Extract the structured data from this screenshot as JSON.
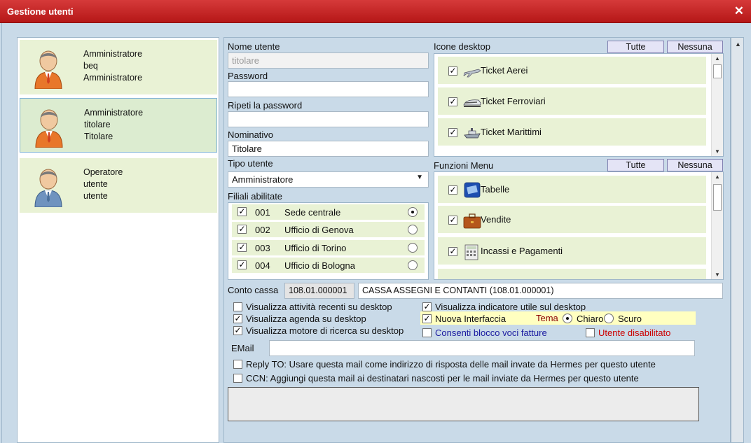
{
  "window": {
    "title": "Gestione utenti",
    "close_icon": "close-icon"
  },
  "users": [
    {
      "line1": "Amministratore",
      "line2": "beq",
      "line3": "Amministratore",
      "avatar_color": "#e8772a"
    },
    {
      "line1": "Amministratore",
      "line2": "titolare",
      "line3": "Titolare",
      "avatar_color": "#e8772a",
      "selected": true
    },
    {
      "line1": "Operatore",
      "line2": "utente",
      "line3": "utente",
      "avatar_color": "#6f93bf"
    }
  ],
  "form": {
    "nome_utente_label": "Nome utente",
    "nome_utente_placeholder": "titolare",
    "password_label": "Password",
    "password_value": "",
    "ripeti_label": "Ripeti la password",
    "ripeti_value": "",
    "nominativo_label": "Nominativo",
    "nominativo_value": "Titolare",
    "tipo_label": "Tipo utente",
    "tipo_value": "Amministratore",
    "filiali_label": "Filiali abilitate",
    "filiali": [
      {
        "code": "001",
        "name": "Sede centrale",
        "checked": true,
        "default": true
      },
      {
        "code": "002",
        "name": "Ufficio di Genova",
        "checked": true,
        "default": false
      },
      {
        "code": "003",
        "name": "Ufficio di Torino",
        "checked": true,
        "default": false
      },
      {
        "code": "004",
        "name": "Ufficio di Bologna",
        "checked": true,
        "default": false
      }
    ],
    "conto_cassa_label": "Conto cassa",
    "conto_cassa_code": "108.01.000001",
    "conto_cassa_desc": "CASSA ASSEGNI E CONTANTI (108.01.000001)",
    "email_label": "EMail",
    "email_value": "",
    "notes_value": ""
  },
  "icone_desktop": {
    "label": "Icone desktop",
    "btn_all": "Tutte",
    "btn_none": "Nessuna",
    "items": [
      {
        "name": "Ticket Aerei",
        "icon": "airplane-icon",
        "checked": true
      },
      {
        "name": "Ticket Ferroviari",
        "icon": "train-icon",
        "checked": true
      },
      {
        "name": "Ticket Marittimi",
        "icon": "ship-icon",
        "checked": true
      }
    ]
  },
  "funzioni_menu": {
    "label": "Funzioni Menu",
    "btn_all": "Tutte",
    "btn_none": "Nessuna",
    "items": [
      {
        "name": "Tabelle",
        "icon": "tables-icon",
        "checked": true
      },
      {
        "name": "Vendite",
        "icon": "briefcase-icon",
        "checked": true
      },
      {
        "name": "Incassi e Pagamenti",
        "icon": "calculator-icon",
        "checked": true
      }
    ]
  },
  "options_left": [
    {
      "label": "Visualizza attività recenti su desktop",
      "checked": false
    },
    {
      "label": "Visualizza agenda su desktop",
      "checked": true
    },
    {
      "label": "Visualizza motore di ricerca su desktop",
      "checked": true
    }
  ],
  "options_right": {
    "indicatore_label": "Visualizza indicatore utile sul desktop",
    "indicatore_checked": true,
    "nuova_label": "Nuova Interfaccia",
    "nuova_checked": true,
    "tema_label": "Tema",
    "chiaro_label": "Chiaro",
    "scuro_label": "Scuro",
    "tema_value": "Chiaro",
    "blocco_label": "Consenti blocco voci fatture",
    "blocco_checked": false,
    "disabilitato_label": "Utente disabilitato",
    "disabilitato_checked": false
  },
  "reply_to_label": "Reply TO: Usare questa mail come indirizzo di risposta delle mail invate da Hermes per questo utente",
  "ccn_label": "CCN: Aggiungi questa mail ai destinatari nascosti per le mail inviate da Hermes per questo utente",
  "colors": {
    "title_bar": "#c62828",
    "card_bg": "#e9f2d5",
    "tema_bg": "#ffffc0",
    "blue_text": "#1a1aa0",
    "red_text": "#cc0000"
  }
}
